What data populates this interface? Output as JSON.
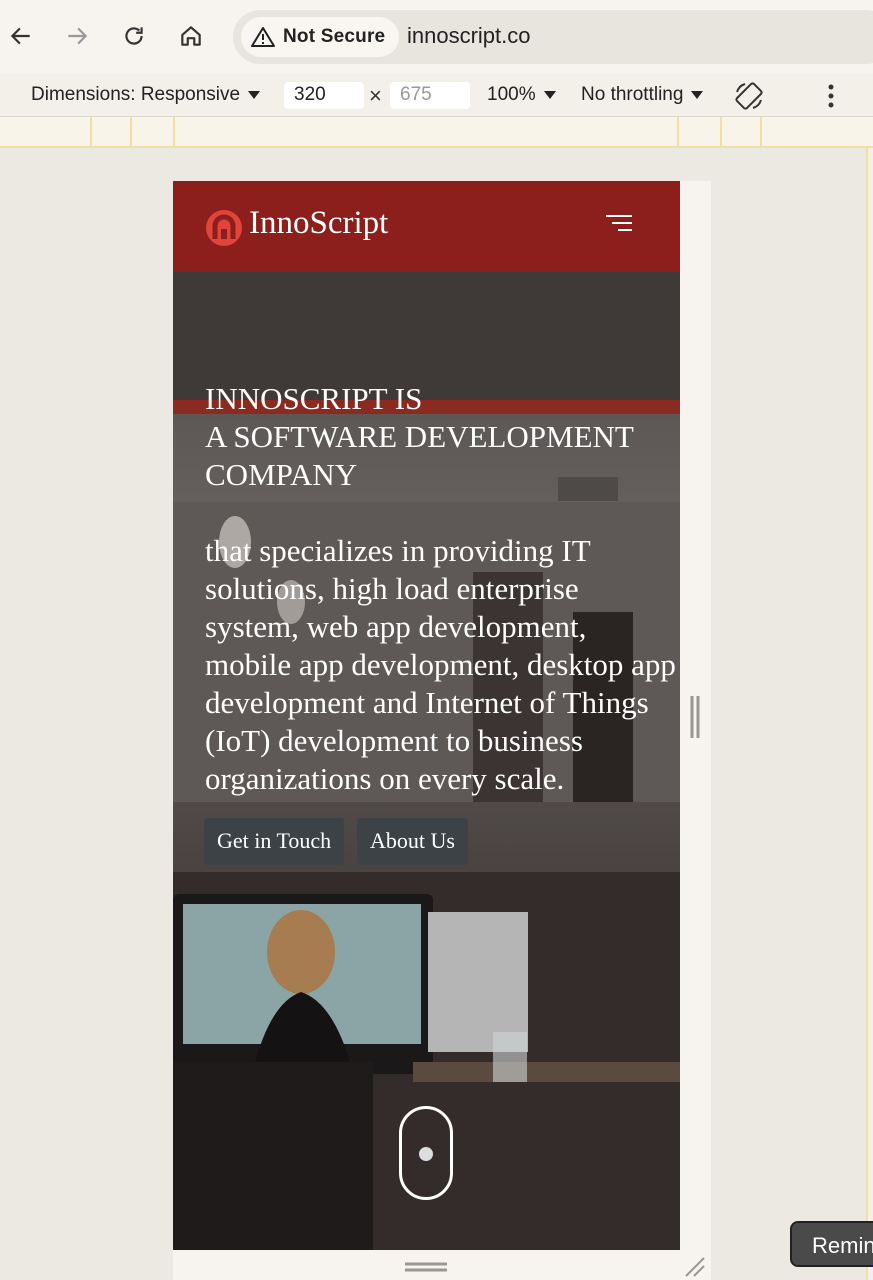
{
  "browser": {
    "security_label": "Not Secure",
    "url": "innoscript.co",
    "icons": [
      "back-arrow-icon",
      "forward-arrow-icon",
      "reload-icon",
      "home-icon",
      "warning-triangle-icon"
    ]
  },
  "devtools": {
    "dimensions_label": "Dimensions: Responsive",
    "width_value": "320",
    "height_placeholder": "675",
    "times_symbol": "×",
    "zoom": "100%",
    "throttling": "No throttling"
  },
  "site": {
    "brand": "InnoScript",
    "accent_color": "#8c1e1c",
    "hero_title_lines": [
      "INNOSCRIPT IS",
      "A SOFTWARE DEVELOPMENT",
      "COMPANY"
    ],
    "hero_text_lines": [
      "that specializes in providing IT",
      "solutions, high load enterprise",
      "system, web app development,",
      "mobile app development, desktop app",
      "development and Internet of Things",
      "(IoT) development to business",
      "organizations on every scale."
    ],
    "buttons": {
      "contact": "Get in Touch",
      "about": "About Us"
    }
  },
  "toast": {
    "text": "Remin"
  }
}
